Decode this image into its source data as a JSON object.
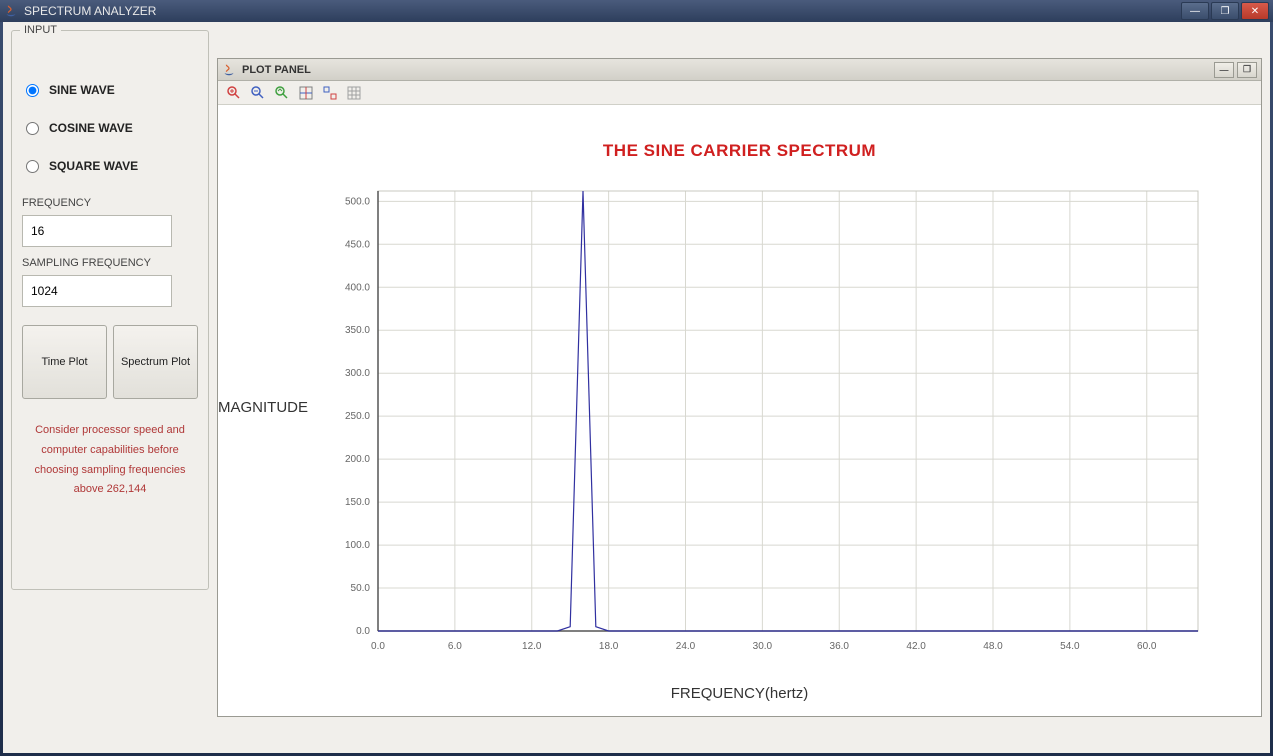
{
  "window": {
    "title": "SPECTRUM ANALYZER"
  },
  "input": {
    "panel_title": "INPUT",
    "radios": {
      "sine": "SINE WAVE",
      "cosine": "COSINE WAVE",
      "square": "SQUARE WAVE",
      "selected": "sine"
    },
    "frequency_label": "FREQUENCY",
    "frequency_value": "16",
    "sampling_label": "SAMPLING FREQUENCY",
    "sampling_value": "1024",
    "buttons": {
      "time_plot": "Time Plot",
      "spectrum_plot": "Spectrum Plot"
    },
    "note": "Consider processor speed and computer capabilities before choosing sampling frequencies above 262,144"
  },
  "plot": {
    "panel_title": "PLOT PANEL",
    "chart_title": "THE SINE CARRIER SPECTRUM",
    "ylabel": "MAGNITUDE",
    "xlabel": "FREQUENCY(hertz)"
  },
  "chart_data": {
    "type": "line",
    "title": "THE SINE CARRIER SPECTRUM",
    "xlabel": "FREQUENCY(hertz)",
    "ylabel": "MAGNITUDE",
    "xlim": [
      0,
      64
    ],
    "ylim": [
      0,
      512
    ],
    "x_ticks": [
      0.0,
      6.0,
      12.0,
      18.0,
      24.0,
      30.0,
      36.0,
      42.0,
      48.0,
      54.0,
      60.0
    ],
    "y_ticks": [
      0.0,
      50.0,
      100.0,
      150.0,
      200.0,
      250.0,
      300.0,
      350.0,
      400.0,
      450.0,
      500.0
    ],
    "series": [
      {
        "name": "spectrum",
        "x": [
          0,
          14,
          15,
          16,
          17,
          18,
          64
        ],
        "y": [
          0,
          0,
          5,
          512,
          5,
          0,
          0
        ]
      }
    ]
  }
}
